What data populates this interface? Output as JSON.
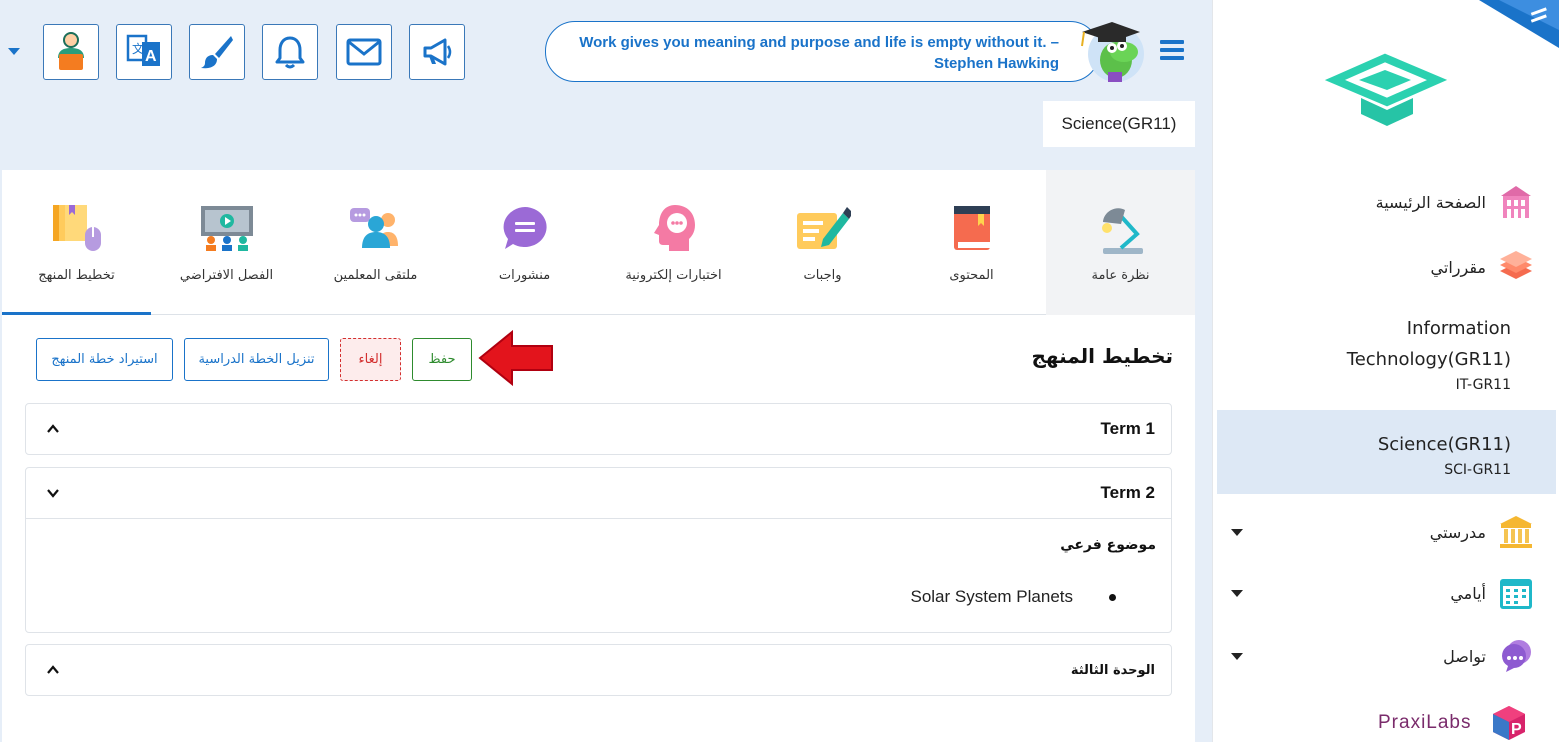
{
  "header": {
    "quote_line1": "Work gives you meaning and purpose and life is empty without it. –",
    "quote_line2": "Stephen Hawking",
    "course_tag": "Science(GR11)"
  },
  "toolbar": {
    "icons": [
      "profile-icon",
      "translate-icon",
      "brush-icon",
      "bell-icon",
      "mail-icon",
      "megaphone-icon"
    ]
  },
  "tabs": [
    {
      "label": "نظرة عامة",
      "icon": "desk-lamp-icon"
    },
    {
      "label": "المحتوى",
      "icon": "book-icon"
    },
    {
      "label": "واجبات",
      "icon": "assignment-icon"
    },
    {
      "label": "اختبارات إلكترونية",
      "icon": "quiz-head-icon"
    },
    {
      "label": "منشورات",
      "icon": "chat-bubble-icon"
    },
    {
      "label": "ملتقى المعلمين",
      "icon": "teachers-forum-icon"
    },
    {
      "label": "الفصل الافتراضي",
      "icon": "virtual-class-icon"
    },
    {
      "label": "تخطيط المنهج",
      "icon": "curriculum-plan-icon"
    }
  ],
  "main": {
    "title": "تخطيط المنهج",
    "buttons": {
      "save": "حفظ",
      "cancel": "إلغاء",
      "download": "تنزيل الخطة الدراسية",
      "import": "استيراد خطة المنهج"
    },
    "sections": [
      {
        "title": "Term 1",
        "expanded": false
      },
      {
        "title": "Term 2",
        "expanded": true,
        "subtopic_label": "موضوع فرعي",
        "items": [
          "Solar System Planets"
        ]
      },
      {
        "title": "الوحدة الثالثة",
        "expanded": false
      }
    ]
  },
  "sidebar": {
    "home": "الصفحة الرئيسية",
    "my_courses": "مقرراتي",
    "courses": [
      {
        "name_line1": "Information",
        "name_line2": "Technology(GR11)",
        "code": "IT-GR11"
      },
      {
        "name": "Science(GR11)",
        "code": "SCI-GR11"
      }
    ],
    "my_school": "مدرستي",
    "my_days": "أيامي",
    "communication": "تواصل",
    "brand": "PraxiLabs"
  },
  "colors": {
    "accent": "#1a73c9",
    "background": "#e6eef8",
    "save": "#2e8b2e",
    "cancel": "#d32f2f",
    "active_course_bg": "#dde8f5"
  }
}
